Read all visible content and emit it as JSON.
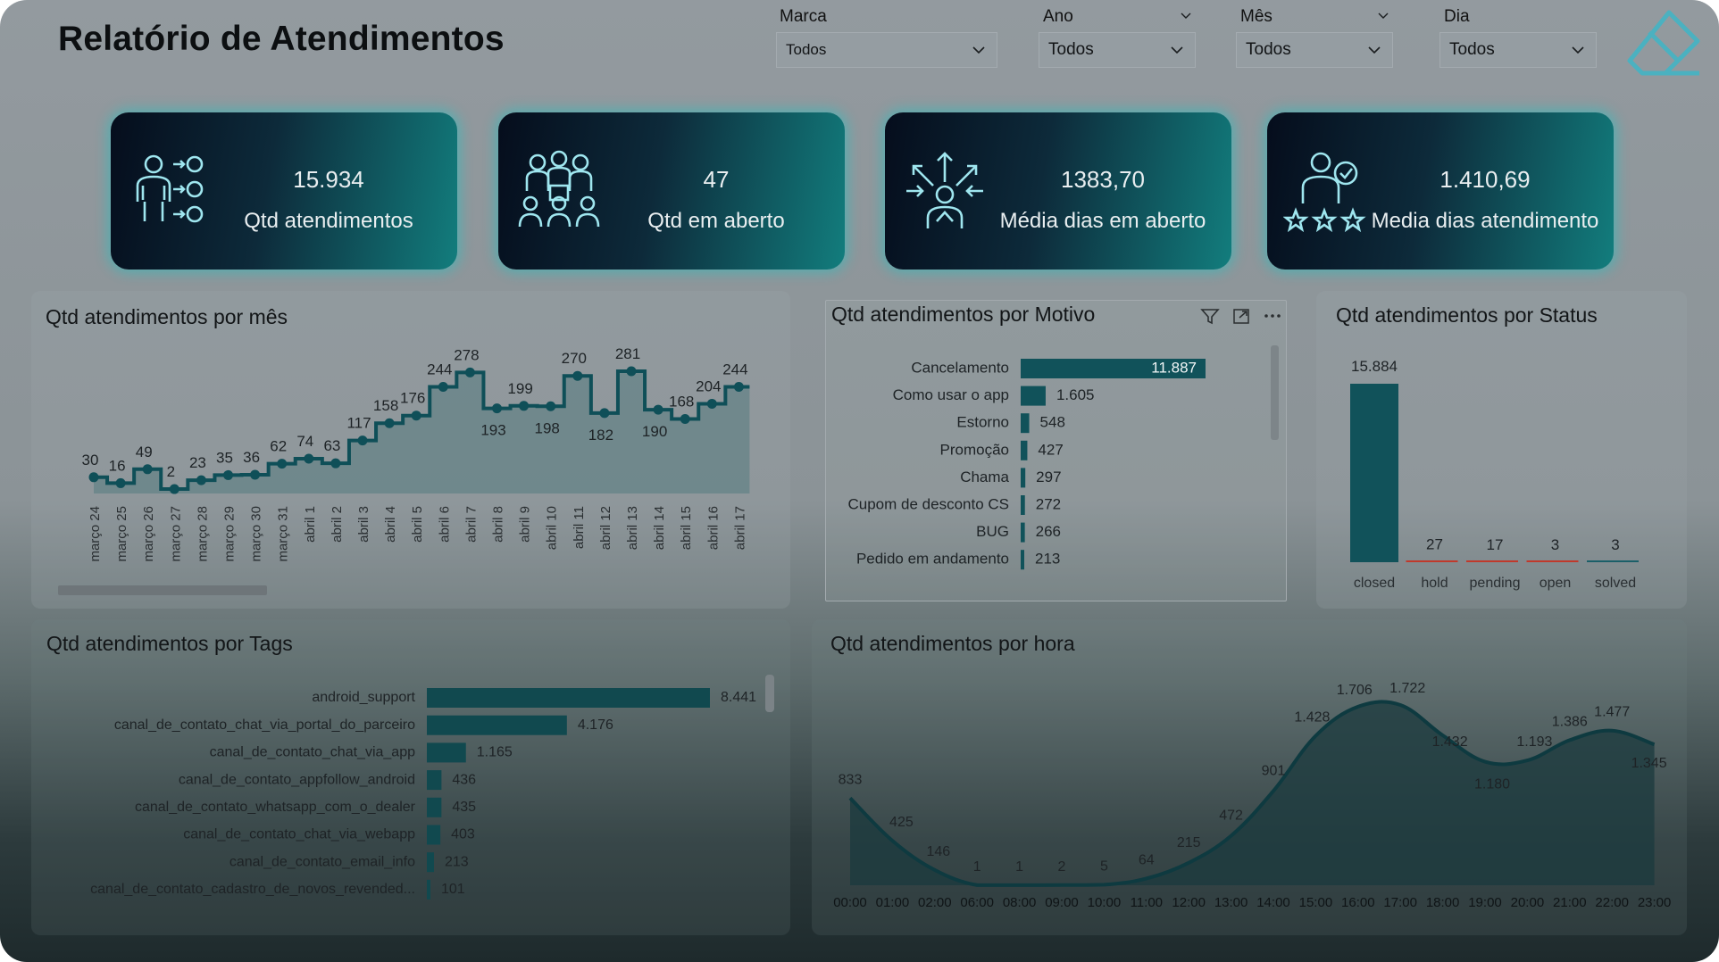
{
  "title": "Relatório de Atendimentos",
  "filters": {
    "marca": {
      "label": "Marca",
      "value": "Todos"
    },
    "ano": {
      "label": "Ano",
      "value": "Todos"
    },
    "mes": {
      "label": "Mês",
      "value": "Todos"
    },
    "dia": {
      "label": "Dia",
      "value": "Todos"
    }
  },
  "kpis": [
    {
      "value": "15.934",
      "label": "Qtd atendimentos",
      "icon": "people-network-icon"
    },
    {
      "value": "47",
      "label": "Qtd em aberto",
      "icon": "team-icon"
    },
    {
      "value": "1383,70",
      "label": "Média dias em aberto",
      "icon": "person-arrows-icon"
    },
    {
      "value": "1.410,69",
      "label": "Media dias atendimento",
      "icon": "person-rating-icon"
    }
  ],
  "colors": {
    "accent": "#0f4f58",
    "kpi_glow": "#14c8c8",
    "status_line": "#c0392b"
  },
  "panels": {
    "month": {
      "title": "Qtd atendimentos por mês"
    },
    "reason": {
      "title": "Qtd atendimentos por Motivo"
    },
    "status": {
      "title": "Qtd atendimentos por Status"
    },
    "tags": {
      "title": "Qtd atendimentos por Tags"
    },
    "hour": {
      "title": "Qtd atendimentos por hora"
    }
  },
  "chart_data": [
    {
      "id": "month",
      "type": "area",
      "title": "Qtd atendimentos por mês",
      "x": [
        "março 24",
        "março 25",
        "março 26",
        "março 27",
        "março 28",
        "março 29",
        "março 30",
        "março 31",
        "abril 1",
        "abril 2",
        "abril 3",
        "abril 4",
        "abril 5",
        "abril 6",
        "abril 7",
        "abril 8",
        "abril 9",
        "abril 10",
        "abril 11",
        "abril 12",
        "abril 13",
        "abril 14",
        "abril 15",
        "abril 16",
        "abril 17"
      ],
      "values": [
        30,
        16,
        49,
        2,
        23,
        35,
        36,
        62,
        74,
        63,
        117,
        158,
        176,
        244,
        278,
        193,
        199,
        198,
        270,
        182,
        281,
        190,
        168,
        204,
        244
      ]
    },
    {
      "id": "reason",
      "type": "bar",
      "orientation": "horizontal",
      "title": "Qtd atendimentos por Motivo",
      "categories": [
        "Cancelamento",
        "Como usar o app",
        "Estorno",
        "Promoção",
        "Chama",
        "Cupom de desconto CS",
        "BUG",
        "Pedido em andamento"
      ],
      "values": [
        11887,
        1605,
        548,
        427,
        297,
        272,
        266,
        213
      ],
      "value_labels": [
        "11.887",
        "1.605",
        "548",
        "427",
        "297",
        "272",
        "266",
        "213"
      ]
    },
    {
      "id": "status",
      "type": "bar",
      "title": "Qtd atendimentos por Status",
      "categories": [
        "closed",
        "hold",
        "pending",
        "open",
        "solved"
      ],
      "values": [
        15884,
        27,
        17,
        3,
        3
      ],
      "value_labels": [
        "15.884",
        "27",
        "17",
        "3",
        "3"
      ]
    },
    {
      "id": "tags",
      "type": "bar",
      "orientation": "horizontal",
      "title": "Qtd atendimentos por Tags",
      "categories": [
        "android_support",
        "canal_de_contato_chat_via_portal_do_parceiro",
        "canal_de_contato_chat_via_app",
        "canal_de_contato_appfollow_android",
        "canal_de_contato_whatsapp_com_o_dealer",
        "canal_de_contato_chat_via_webapp",
        "canal_de_contato_email_info",
        "canal_de_contato_cadastro_de_novos_revended..."
      ],
      "values": [
        8441,
        4176,
        1165,
        436,
        435,
        403,
        213,
        101
      ],
      "value_labels": [
        "8.441",
        "4.176",
        "1.165",
        "436",
        "435",
        "403",
        "213",
        "101"
      ]
    },
    {
      "id": "hour",
      "type": "area",
      "title": "Qtd atendimentos por hora",
      "x": [
        "00:00",
        "01:00",
        "02:00",
        "06:00",
        "08:00",
        "09:00",
        "10:00",
        "11:00",
        "12:00",
        "13:00",
        "14:00",
        "15:00",
        "16:00",
        "17:00",
        "18:00",
        "19:00",
        "20:00",
        "21:00",
        "22:00",
        "23:00"
      ],
      "values": [
        833,
        425,
        146,
        1,
        1,
        2,
        5,
        64,
        215,
        472,
        901,
        1428,
        1706,
        1722,
        1432,
        1180,
        1193,
        1386,
        1477,
        1345
      ],
      "value_labels": [
        "833",
        "425",
        "146",
        "1",
        "1",
        "2",
        "5",
        "64",
        "215",
        "472",
        "901",
        "1.428",
        "1.706",
        "1.722",
        "1.432",
        "1.180",
        "1.193",
        "1.386",
        "1.477",
        "1.345"
      ]
    }
  ]
}
